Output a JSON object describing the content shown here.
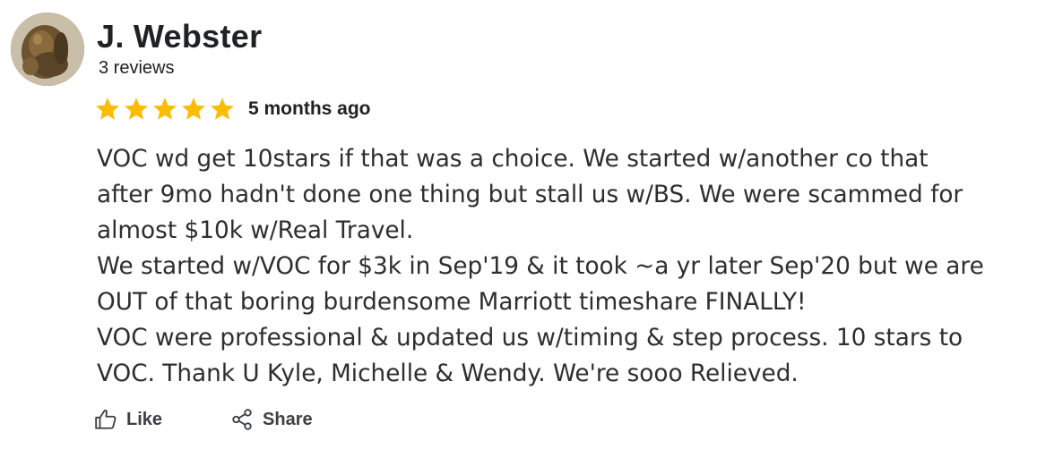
{
  "reviewer": {
    "name": "J. Webster",
    "reviews_count": "3 reviews"
  },
  "rating": {
    "stars": 5,
    "max_stars": 5,
    "time_ago": "5 months ago",
    "star_color": "#fbbc04"
  },
  "review": {
    "lines": [
      "VOC wd get 10stars if that was a choice. We started w/another co that",
      "after 9mo hadn't done one thing but stall us w/BS. We were scammed for",
      "almost $10k w/Real Travel.",
      "We started w/VOC for $3k in Sep'19 & it took ~a yr later Sep'20 but we are",
      "OUT of that boring burdensome Marriott timeshare FINALLY!",
      "VOC were professional & updated us w/timing & step process. 10 stars to",
      "VOC. Thank U Kyle, Michelle & Wendy. We're sooo Relieved."
    ]
  },
  "actions": {
    "like_label": "Like",
    "like_icon": "thumbs-up-icon",
    "share_label": "Share",
    "share_icon": "share-icon"
  }
}
